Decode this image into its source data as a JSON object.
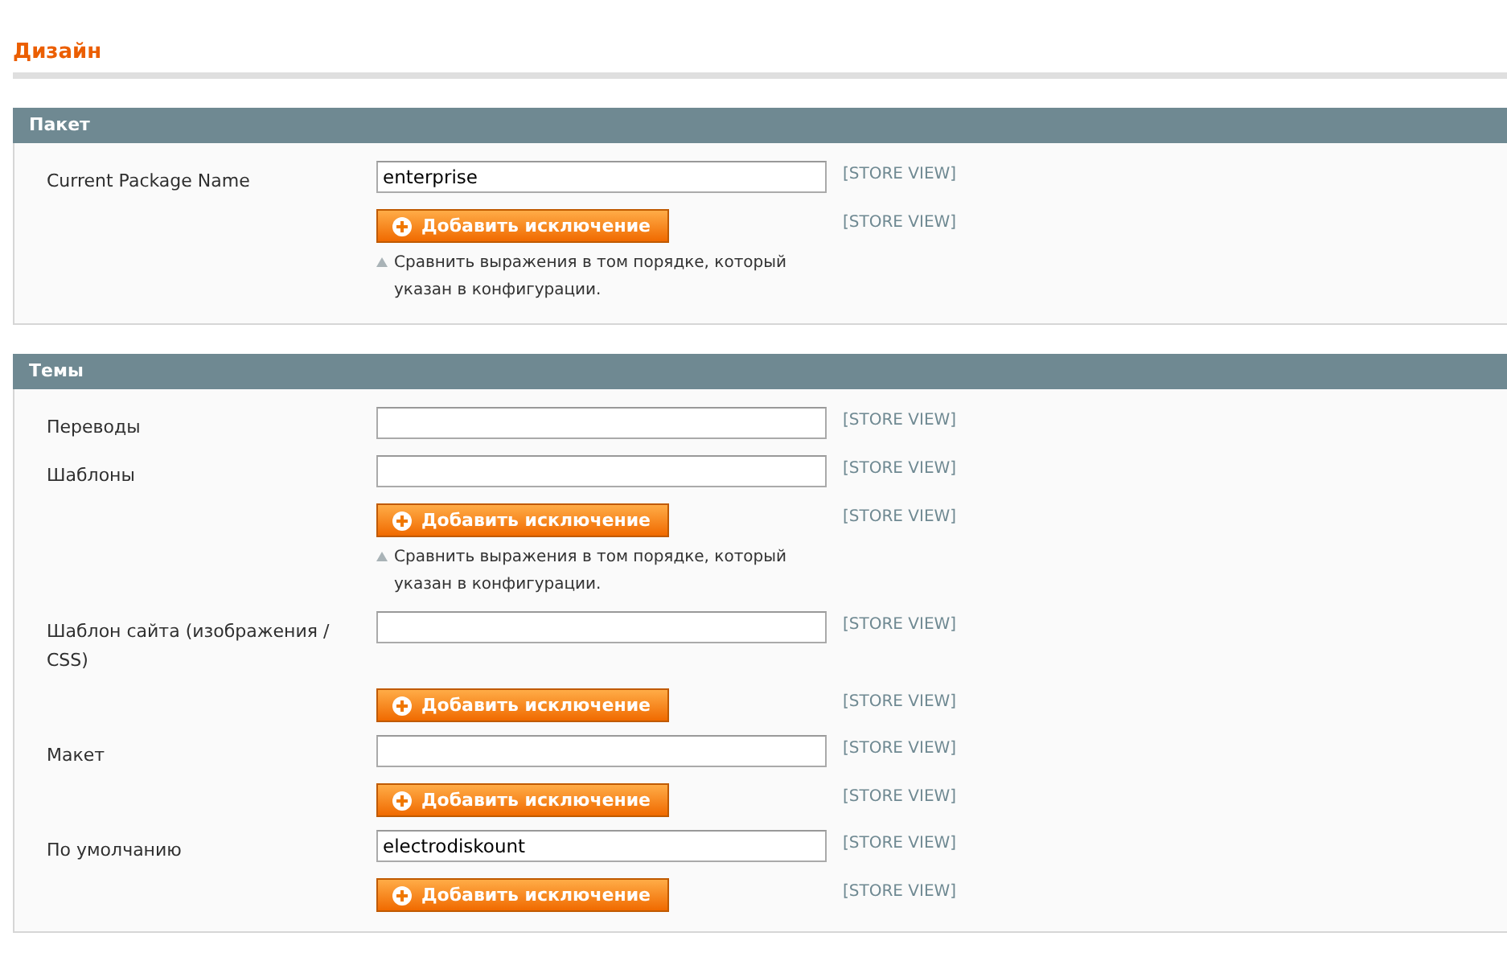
{
  "title": "Дизайн",
  "sections": [
    {
      "title": "Пакет",
      "rows": [
        {
          "kind": "field",
          "label": "Current Package Name",
          "value": "enterprise",
          "scope": "[STORE VIEW]"
        },
        {
          "kind": "button",
          "button": "Добавить исключение",
          "scope": "[STORE VIEW]",
          "note": "Сравнить выражения в том порядке, который указан в конфигурации."
        }
      ]
    },
    {
      "title": "Темы",
      "rows": [
        {
          "kind": "field",
          "label": "Переводы",
          "scope": "[STORE VIEW]"
        },
        {
          "kind": "field",
          "label": "Шаблоны",
          "scope": "[STORE VIEW]"
        },
        {
          "kind": "button",
          "button": "Добавить исключение",
          "scope": "[STORE VIEW]",
          "note": "Сравнить выражения в том порядке, который указан в конфигурации."
        },
        {
          "kind": "field",
          "label": "Шаблон сайта (изображения / CSS)",
          "scope": "[STORE VIEW]"
        },
        {
          "kind": "button",
          "button": "Добавить исключение",
          "scope": "[STORE VIEW]"
        },
        {
          "kind": "field",
          "label": "Макет",
          "scope": "[STORE VIEW]"
        },
        {
          "kind": "button",
          "button": "Добавить исключение",
          "scope": "[STORE VIEW]"
        },
        {
          "kind": "field",
          "label": "По умолчанию",
          "value": "electrodiskount",
          "scope": "[STORE VIEW]"
        },
        {
          "kind": "button",
          "button": "Добавить исключение",
          "scope": "[STORE VIEW]"
        }
      ]
    }
  ]
}
